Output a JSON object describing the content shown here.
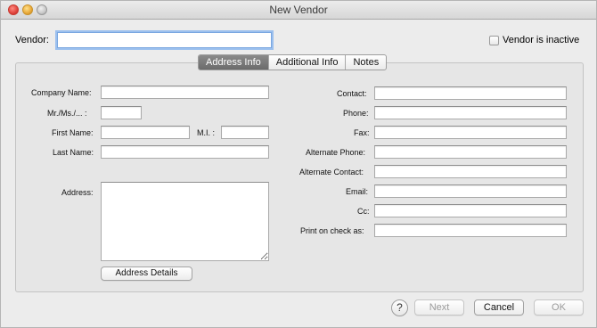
{
  "window": {
    "title": "New Vendor"
  },
  "vendor": {
    "label": "Vendor:",
    "value": "",
    "inactive_label": "Vendor is inactive"
  },
  "tabs": [
    {
      "label": "Address Info",
      "active": true
    },
    {
      "label": "Additional Info",
      "active": false
    },
    {
      "label": "Notes",
      "active": false
    }
  ],
  "left_fields": {
    "company_name": "Company Name:",
    "salutation": "Mr./Ms./... :",
    "first_name": "First Name:",
    "mi": "M.I. :",
    "last_name": "Last Name:",
    "address": "Address:"
  },
  "right_fields": {
    "contact": "Contact:",
    "phone": "Phone:",
    "fax": "Fax:",
    "alt_phone": "Alternate Phone:",
    "alt_contact": "Alternate Contact:",
    "email": "Email:",
    "cc": "Cc:",
    "print_on_check": "Print on check as:"
  },
  "buttons": {
    "address_details": "Address Details",
    "help": "?",
    "next": "Next",
    "cancel": "Cancel",
    "ok": "OK"
  }
}
